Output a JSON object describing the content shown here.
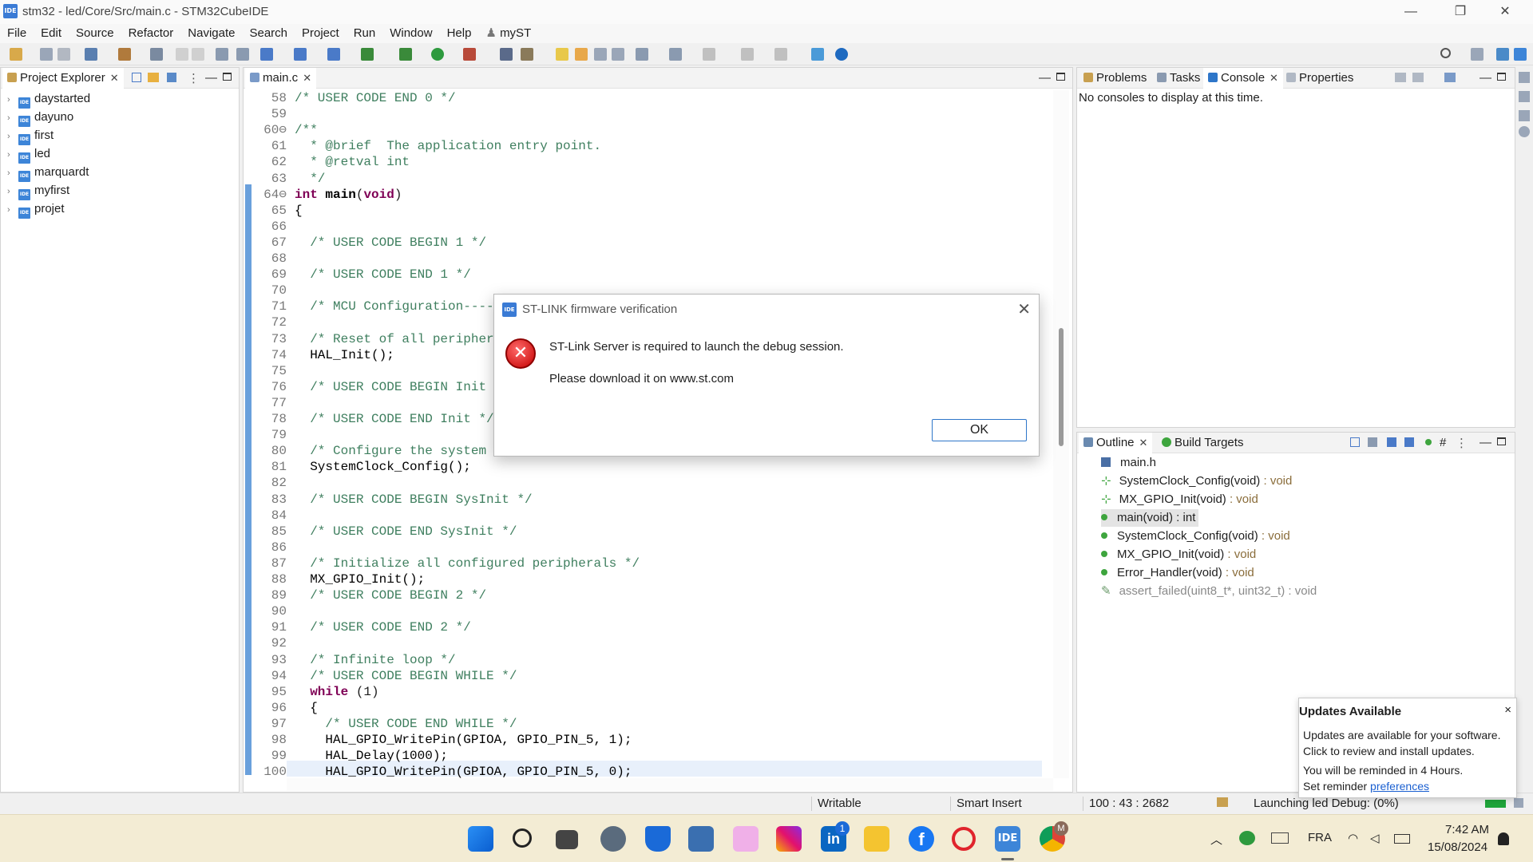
{
  "window": {
    "title": "stm32 - led/Core/Src/main.c - STM32CubeIDE",
    "app_icon": "IDE",
    "minimize": "—",
    "restore": "❐",
    "close": "✕"
  },
  "menu": [
    "File",
    "Edit",
    "Source",
    "Refactor",
    "Navigate",
    "Search",
    "Project",
    "Run",
    "Window",
    "Help",
    "myST"
  ],
  "project_explorer": {
    "tab_label": "Project Explorer",
    "projects": [
      "daystarted",
      "dayuno",
      "first",
      "led",
      "marquardt",
      "myfirst",
      "projet"
    ]
  },
  "editor": {
    "tab_label": "main.c",
    "lines": [
      {
        "n": "58",
        "t": "/* USER CODE END 0 */",
        "c": "cmt"
      },
      {
        "n": "59",
        "t": "",
        "c": "plain"
      },
      {
        "n": "60⊖",
        "t": "/**",
        "c": "cmt"
      },
      {
        "n": "61",
        "t": "  * @brief  The application entry point.",
        "c": "cmt"
      },
      {
        "n": "62",
        "t": "  * @retval int",
        "c": "cmt"
      },
      {
        "n": "63",
        "t": "  */",
        "c": "cmt"
      },
      {
        "n": "64⊖",
        "t": "int main(void)",
        "c": "sig"
      },
      {
        "n": "65",
        "t": "{",
        "c": "plain"
      },
      {
        "n": "66",
        "t": "",
        "c": "plain"
      },
      {
        "n": "67",
        "t": "  /* USER CODE BEGIN 1 */",
        "c": "cmt"
      },
      {
        "n": "68",
        "t": "",
        "c": "plain"
      },
      {
        "n": "69",
        "t": "  /* USER CODE END 1 */",
        "c": "cmt"
      },
      {
        "n": "70",
        "t": "",
        "c": "plain"
      },
      {
        "n": "71",
        "t": "  /* MCU Configuration--------------------------------------------------------*/",
        "c": "cmt"
      },
      {
        "n": "72",
        "t": "",
        "c": "plain"
      },
      {
        "n": "73",
        "t": "  /* Reset of all peripherals, Initializes the Flash interface and the Systick. */",
        "c": "cmt"
      },
      {
        "n": "74",
        "t": "  HAL_Init();",
        "c": "plain"
      },
      {
        "n": "75",
        "t": "",
        "c": "plain"
      },
      {
        "n": "76",
        "t": "  /* USER CODE BEGIN Init */",
        "c": "cmt"
      },
      {
        "n": "77",
        "t": "",
        "c": "plain"
      },
      {
        "n": "78",
        "t": "  /* USER CODE END Init */",
        "c": "cmt"
      },
      {
        "n": "79",
        "t": "",
        "c": "plain"
      },
      {
        "n": "80",
        "t": "  /* Configure the system clock */",
        "c": "cmt"
      },
      {
        "n": "81",
        "t": "  SystemClock_Config();",
        "c": "plain"
      },
      {
        "n": "82",
        "t": "",
        "c": "plain"
      },
      {
        "n": "83",
        "t": "  /* USER CODE BEGIN SysInit */",
        "c": "cmt"
      },
      {
        "n": "84",
        "t": "",
        "c": "plain"
      },
      {
        "n": "85",
        "t": "  /* USER CODE END SysInit */",
        "c": "cmt"
      },
      {
        "n": "86",
        "t": "",
        "c": "plain"
      },
      {
        "n": "87",
        "t": "  /* Initialize all configured peripherals */",
        "c": "cmt"
      },
      {
        "n": "88",
        "t": "  MX_GPIO_Init();",
        "c": "plain"
      },
      {
        "n": "89",
        "t": "  /* USER CODE BEGIN 2 */",
        "c": "cmt"
      },
      {
        "n": "90",
        "t": "",
        "c": "plain"
      },
      {
        "n": "91",
        "t": "  /* USER CODE END 2 */",
        "c": "cmt"
      },
      {
        "n": "92",
        "t": "",
        "c": "plain"
      },
      {
        "n": "93",
        "t": "  /* Infinite loop */",
        "c": "cmt"
      },
      {
        "n": "94",
        "t": "  /* USER CODE BEGIN WHILE */",
        "c": "cmt"
      },
      {
        "n": "95",
        "t": "  while (1)",
        "c": "while"
      },
      {
        "n": "96",
        "t": "  {",
        "c": "plain"
      },
      {
        "n": "97",
        "t": "    /* USER CODE END WHILE */",
        "c": "cmt"
      },
      {
        "n": "98",
        "t": "    HAL_GPIO_WritePin(GPIOA, GPIO_PIN_5, 1);",
        "c": "plain"
      },
      {
        "n": "99",
        "t": "    HAL_Delay(1000);",
        "c": "plain"
      },
      {
        "n": "100",
        "t": "    HAL_GPIO_WritePin(GPIOA, GPIO_PIN_5, 0);",
        "c": "plain"
      }
    ]
  },
  "right_panel": {
    "tabs": [
      "Problems",
      "Tasks",
      "Console",
      "Properties"
    ],
    "console_message": "No consoles to display at this time."
  },
  "outline": {
    "tabs": [
      "Outline",
      "Build Targets"
    ],
    "items": [
      {
        "name": "main.h",
        "type": "",
        "kind": "header"
      },
      {
        "name": "SystemClock_Config(void)",
        "type": " : void",
        "kind": "decl"
      },
      {
        "name": "MX_GPIO_Init(void)",
        "type": " : void",
        "kind": "decl-static"
      },
      {
        "name": "main(void) : int",
        "type": "",
        "kind": "func-selected"
      },
      {
        "name": "SystemClock_Config(void)",
        "type": " : void",
        "kind": "func"
      },
      {
        "name": "MX_GPIO_Init(void)",
        "type": " : void",
        "kind": "func-static"
      },
      {
        "name": "Error_Handler(void)",
        "type": " : void",
        "kind": "func"
      },
      {
        "name": "assert_failed(uint8_t*, uint32_t)",
        "type": " : void",
        "kind": "disabled"
      }
    ]
  },
  "dialog": {
    "title": "ST-LINK firmware verification",
    "message_line1": "ST-Link Server is required to launch the debug session.",
    "message_line2": "Please download it on www.st.com",
    "ok_label": "OK",
    "icon": "error-icon"
  },
  "status": {
    "writable": "Writable",
    "insert_mode": "Smart Insert",
    "position": "100 : 43 : 2682",
    "launching": "Launching led Debug: (0%)"
  },
  "notification": {
    "title": "Updates Available",
    "line1": "Updates are available for your software.",
    "line2": "Click to review and install updates.",
    "line3": "You will be reminded in 4 Hours.",
    "line4_prefix": "Set reminder ",
    "line4_link": "preferences",
    "close": "×"
  },
  "taskbar": {
    "language": "FRA",
    "time": "7:42 AM",
    "date": "15/08/2024",
    "linkedin_badge": "1",
    "chrome_badge": "M",
    "ide_label": "IDE"
  },
  "colors": {
    "accent": "#2e76c9",
    "comment": "#3f7f5f",
    "keyword": "#7f0055",
    "taskbar": "#f3ecd4"
  }
}
